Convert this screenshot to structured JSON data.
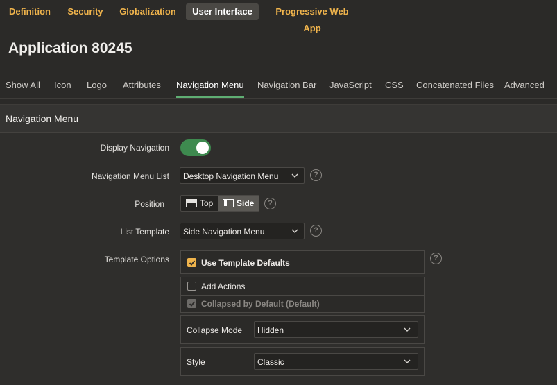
{
  "top_tabs": [
    {
      "label": "Definition"
    },
    {
      "label": "Security"
    },
    {
      "label": "Globalization"
    },
    {
      "label": "User Interface"
    },
    {
      "label": "Progressive Web App"
    }
  ],
  "app_title": "Application 80245",
  "sub_tabs": [
    {
      "label": "Show All"
    },
    {
      "label": "Icon"
    },
    {
      "label": "Logo"
    },
    {
      "label": "Attributes"
    },
    {
      "label": "Navigation Menu"
    },
    {
      "label": "Navigation Bar"
    },
    {
      "label": "JavaScript"
    },
    {
      "label": "CSS"
    },
    {
      "label": "Concatenated Files"
    },
    {
      "label": "Advanced"
    }
  ],
  "active_top_tab": "User Interface",
  "active_sub_tab": "Navigation Menu",
  "region_title": "Navigation Menu",
  "form": {
    "display_navigation": {
      "label": "Display Navigation",
      "value": true
    },
    "navigation_menu_list": {
      "label": "Navigation Menu List",
      "value": "Desktop Navigation Menu"
    },
    "position": {
      "label": "Position",
      "options": [
        "Top",
        "Side"
      ],
      "selected": "Side"
    },
    "list_template": {
      "label": "List Template",
      "value": "Side Navigation Menu"
    },
    "template_options": {
      "label": "Template Options",
      "use_template_defaults": {
        "label": "Use Template Defaults",
        "checked": true
      },
      "add_actions": {
        "label": "Add Actions",
        "checked": false
      },
      "collapsed_by_default": {
        "label": "Collapsed by Default (Default)",
        "checked": true,
        "disabled": true
      },
      "collapse_mode": {
        "label": "Collapse Mode",
        "value": "Hidden"
      },
      "style": {
        "label": "Style",
        "value": "Classic"
      }
    }
  },
  "help_glyph": "?",
  "colors": {
    "accent_orange": "#f0b44c",
    "toggle_green": "#3e8a4f",
    "tab_underline": "#5fae73",
    "background": "#2b2a28"
  },
  "icons": [
    "help-icon",
    "chevron-down-icon",
    "position-top-icon",
    "position-side-icon",
    "checkmark-icon"
  ]
}
